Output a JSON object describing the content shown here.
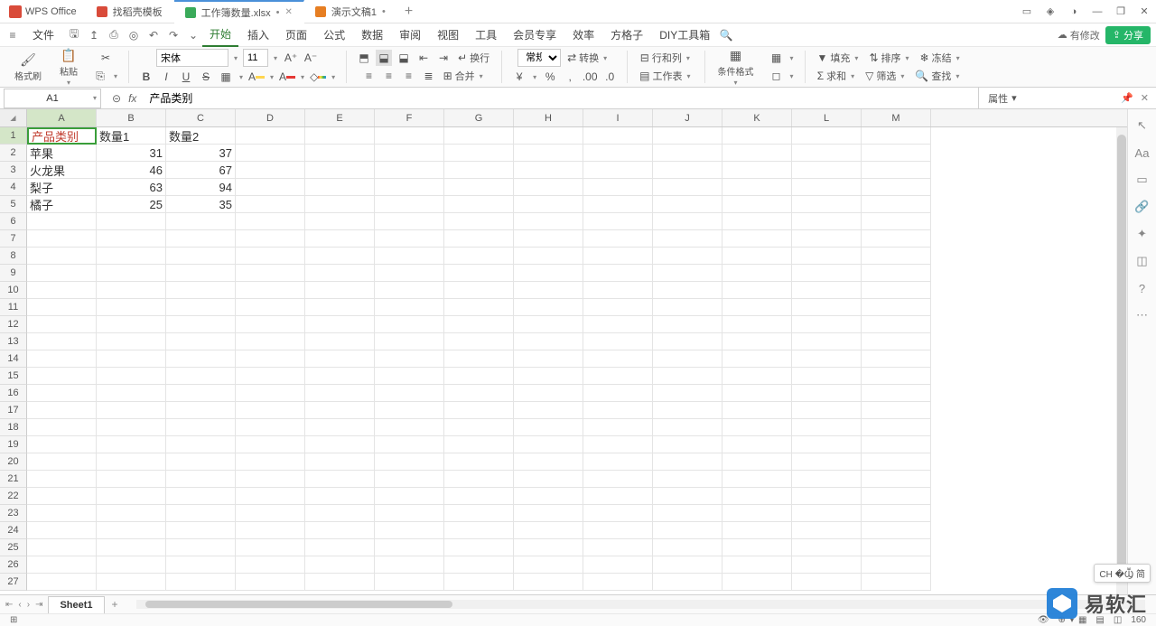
{
  "app_name": "WPS Office",
  "tabs": [
    {
      "label": "找稻壳模板",
      "icon": "red"
    },
    {
      "label": "工作簿数量.xlsx",
      "icon": "green",
      "dirty": "•"
    },
    {
      "label": "演示文稿1",
      "icon": "orange",
      "dirty": "•"
    }
  ],
  "menu": {
    "file": "文件",
    "items": [
      "开始",
      "插入",
      "页面",
      "公式",
      "数据",
      "审阅",
      "视图",
      "工具",
      "会员专享",
      "效率",
      "方格子",
      "DIY工具箱"
    ],
    "cloud": "有修改",
    "share": "分享"
  },
  "ribbon": {
    "format_brush": "格式刷",
    "paste": "粘贴",
    "font_name": "宋体",
    "font_size": "11",
    "wrap": "换行",
    "number_format": "常规",
    "convert": "转换",
    "row_col": "行和列",
    "worksheet": "工作表",
    "cond_fmt": "条件格式",
    "fill": "填充",
    "sort": "排序",
    "freeze": "冻结",
    "sum": "求和",
    "filter": "筛选",
    "find": "查找",
    "merge": "合并"
  },
  "formula_bar": {
    "cell_ref": "A1",
    "formula": "产品类别",
    "properties": "属性"
  },
  "columns": [
    "A",
    "B",
    "C",
    "D",
    "E",
    "F",
    "G",
    "H",
    "I",
    "J",
    "K",
    "L",
    "M"
  ],
  "row_count": 27,
  "cells": {
    "A1": "产品类别",
    "B1": "数量1",
    "C1": "数量2",
    "A2": "苹果",
    "B2": "31",
    "C2": "37",
    "A3": "火龙果",
    "B3": "46",
    "C3": "67",
    "A4": "梨子",
    "B4": "63",
    "C4": "94",
    "A5": "橘子",
    "B5": "25",
    "C5": "35"
  },
  "selected_cell": "A1",
  "sheet": {
    "name": "Sheet1"
  },
  "status": {
    "zoom": "160",
    "ime": "CH �Ⳃ 简"
  },
  "watermark": "易软汇"
}
